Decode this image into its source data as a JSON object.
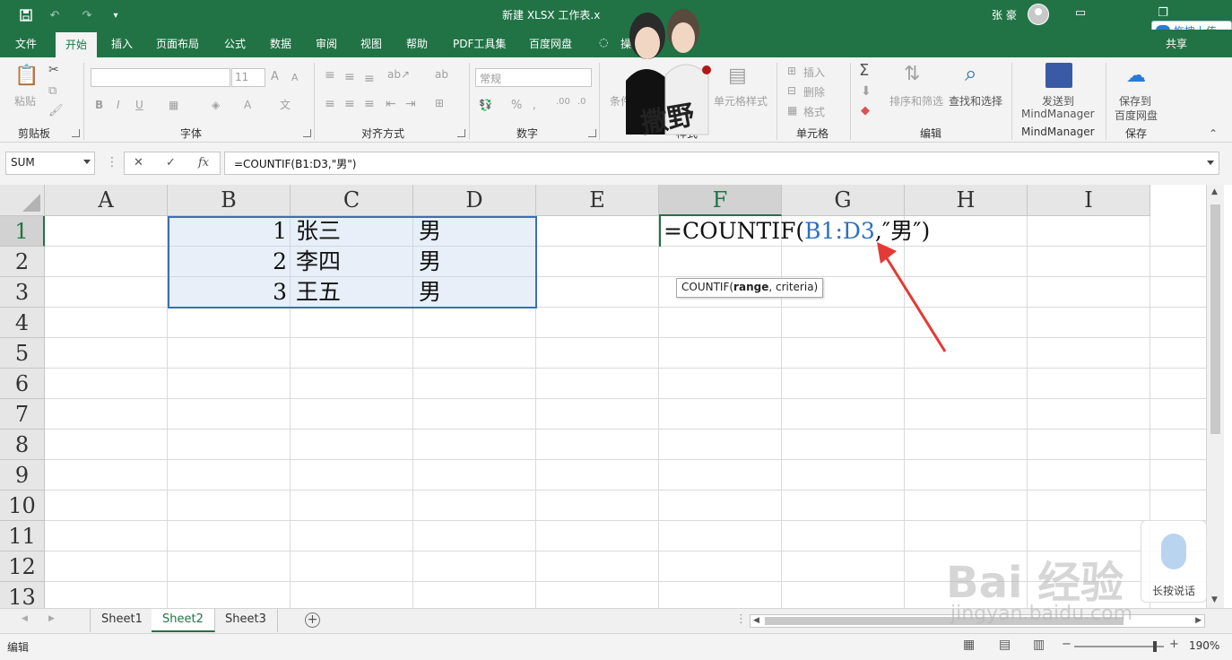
{
  "window": {
    "title": "新建 XLSX 工作表.x",
    "user": "张 豪",
    "upload_label": "拖拽上传",
    "share_label": "共享"
  },
  "tabs": [
    "文件",
    "开始",
    "插入",
    "页面布局",
    "公式",
    "数据",
    "审阅",
    "视图",
    "帮助",
    "PDF工具集",
    "百度网盘",
    "操作"
  ],
  "ribbon": {
    "clipboard": {
      "paste": "粘贴",
      "label": "剪贴板"
    },
    "font": {
      "size": "11",
      "bold": "B",
      "italic": "I",
      "underline": "U",
      "label": "字体"
    },
    "alignment": {
      "label": "对齐方式"
    },
    "number": {
      "format": "常规",
      "percent": "%",
      "label": "数字"
    },
    "styles": {
      "conditional": "条件",
      "cell_styles": "单元格样式",
      "label": "样式"
    },
    "cells": {
      "insert": "插入",
      "delete": "删除",
      "format": "格式",
      "label": "单元格"
    },
    "editing": {
      "sort_filter": "排序和筛选",
      "find_select": "查找和选择",
      "label": "编辑"
    },
    "mindmanager": {
      "send": "发送到",
      "name": "MindManager",
      "label": "MindManager"
    },
    "save": {
      "save_to": "保存到",
      "target": "百度网盘",
      "label": "保存"
    }
  },
  "formula_bar": {
    "name_box": "SUM",
    "cancel": "✕",
    "enter": "✓",
    "fx": "fx",
    "formula": "=COUNTIF(B1:D3,\"男\")"
  },
  "grid": {
    "columns": [
      "A",
      "B",
      "C",
      "D",
      "E",
      "F",
      "G",
      "H",
      "I"
    ],
    "rows": [
      "1",
      "2",
      "3",
      "4",
      "5",
      "6",
      "7",
      "8",
      "9",
      "10",
      "11",
      "12",
      "13"
    ],
    "selected_column": "F",
    "selected_row": "1",
    "cells": [
      {
        "ref": "B1",
        "value": "1"
      },
      {
        "ref": "C1",
        "value": "张三"
      },
      {
        "ref": "D1",
        "value": "男"
      },
      {
        "ref": "B2",
        "value": "2"
      },
      {
        "ref": "C2",
        "value": "李四"
      },
      {
        "ref": "D2",
        "value": "男"
      },
      {
        "ref": "B3",
        "value": "3"
      },
      {
        "ref": "C3",
        "value": "王五"
      },
      {
        "ref": "D3",
        "value": "男"
      }
    ],
    "editing": {
      "prefix": "=COUNTIF(",
      "ref": "B1:D3",
      "suffix": ",″男″)"
    },
    "tooltip": {
      "fn": "COUNTIF(",
      "arg1": "range",
      "rest": ", criteria)"
    }
  },
  "sheets": [
    "Sheet1",
    "Sheet2",
    "Sheet3"
  ],
  "active_sheet": "Sheet2",
  "status": {
    "mode": "编辑",
    "zoom": "190%"
  },
  "overlays": {
    "watermark": "Bai 经验",
    "watermark_url": "jingyan.baidu.com",
    "voice_label": "长按说话",
    "sticker_text": "撒野"
  },
  "colors": {
    "accent": "#217346",
    "ref_blue": "#2e6fbf",
    "arrow": "#e53935"
  }
}
